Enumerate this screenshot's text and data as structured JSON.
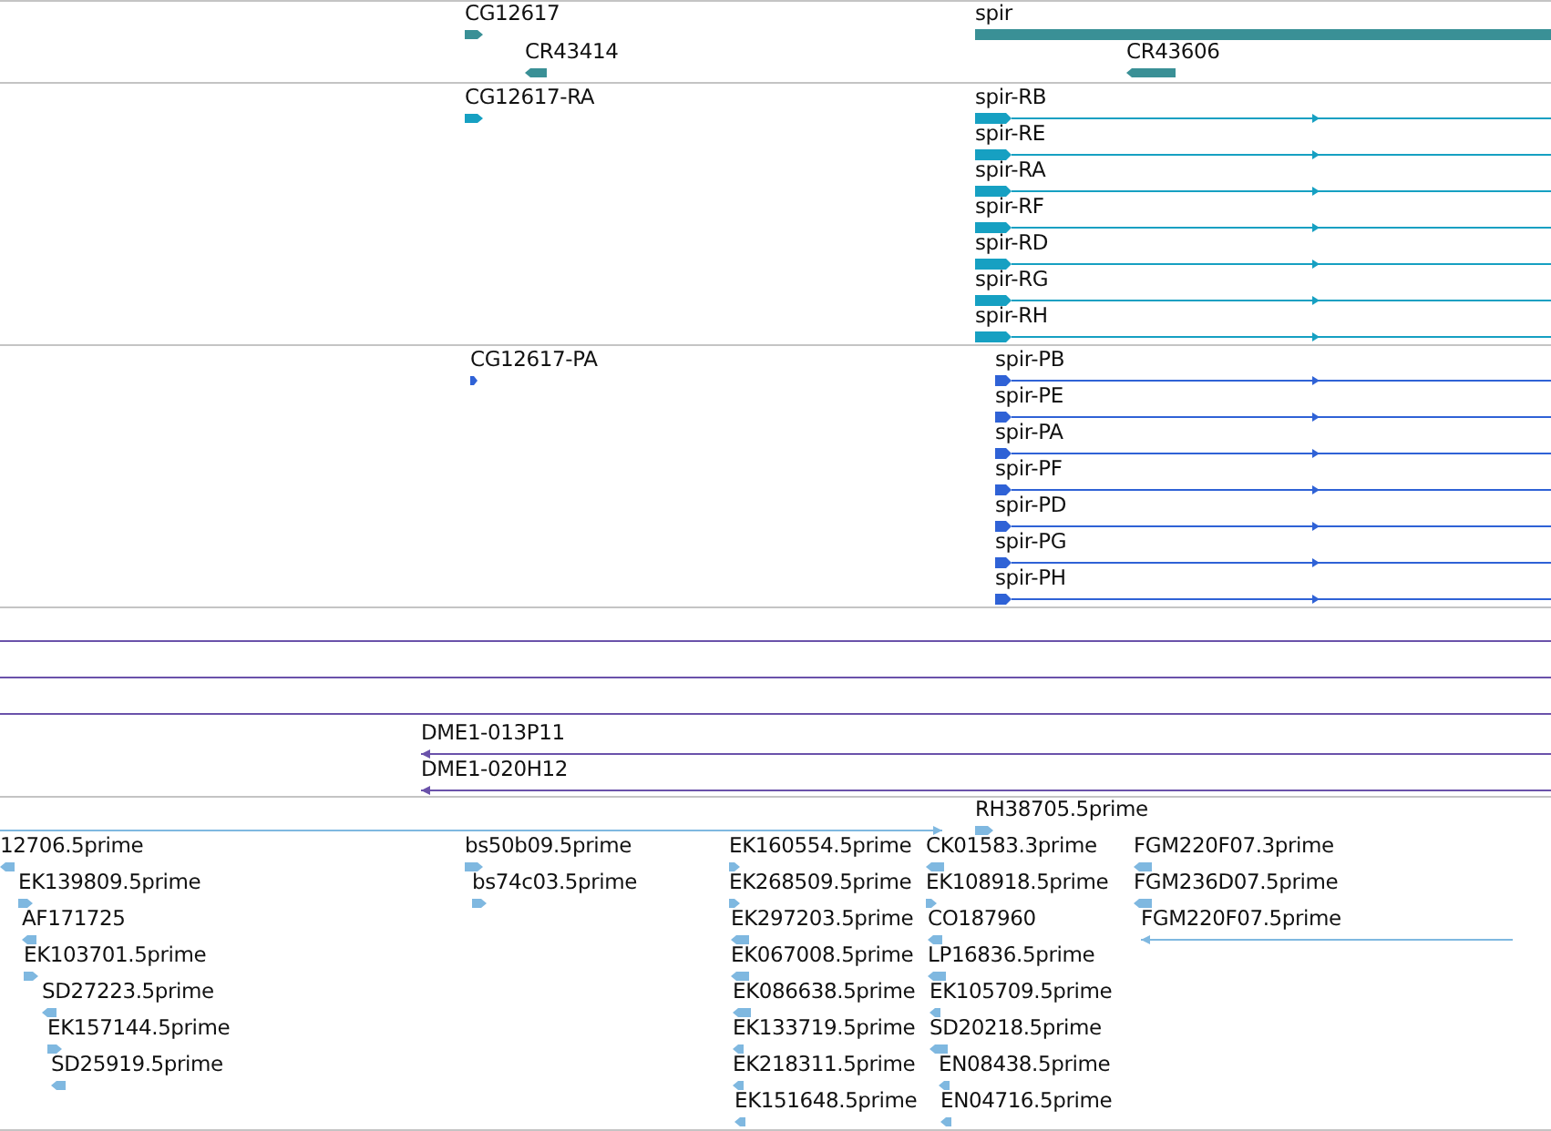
{
  "tracks": [
    {
      "color": "#3a9096",
      "features": [
        {
          "kind": "block",
          "label": "CG12617",
          "reverse": false
        },
        {
          "kind": "block",
          "label": "CR43414",
          "reverse": true
        },
        {
          "kind": "bar",
          "label": "spir"
        },
        {
          "kind": "block",
          "label": "CR43606",
          "reverse": true
        }
      ]
    },
    {
      "color": "#16a0c2",
      "features": [
        {
          "kind": "block",
          "label": "CG12617-RA",
          "reverse": false
        },
        {
          "kind": "transcript",
          "label": "spir-RB",
          "reverse": false
        },
        {
          "kind": "transcript",
          "label": "spir-RE",
          "reverse": false
        },
        {
          "kind": "transcript",
          "label": "spir-RA",
          "reverse": false
        },
        {
          "kind": "transcript",
          "label": "spir-RF",
          "reverse": false
        },
        {
          "kind": "transcript",
          "label": "spir-RD",
          "reverse": false
        },
        {
          "kind": "transcript",
          "label": "spir-RG",
          "reverse": false
        },
        {
          "kind": "transcript",
          "label": "spir-RH",
          "reverse": false
        }
      ]
    },
    {
      "color": "#2f62d6",
      "features": [
        {
          "kind": "block",
          "label": "CG12617-PA",
          "reverse": false
        },
        {
          "kind": "transcript",
          "label": "spir-PB",
          "reverse": false
        },
        {
          "kind": "transcript",
          "label": "spir-PE",
          "reverse": false
        },
        {
          "kind": "transcript",
          "label": "spir-PA",
          "reverse": false
        },
        {
          "kind": "transcript",
          "label": "spir-PF",
          "reverse": false
        },
        {
          "kind": "transcript",
          "label": "spir-PD",
          "reverse": false
        },
        {
          "kind": "transcript",
          "label": "spir-PG",
          "reverse": false
        },
        {
          "kind": "transcript",
          "label": "spir-PH",
          "reverse": false
        }
      ]
    },
    {
      "color": "#6a52aa",
      "features": [
        {
          "kind": "rule"
        },
        {
          "kind": "rule"
        },
        {
          "kind": "rule"
        },
        {
          "kind": "line",
          "label": "DME1-013P11",
          "reverse": true
        },
        {
          "kind": "line",
          "label": "DME1-020H12",
          "reverse": true
        }
      ]
    },
    {
      "color": "#7fb8e0",
      "features": [
        {
          "kind": "line",
          "reverse": false
        },
        {
          "kind": "block",
          "label": "RH38705.5prime",
          "reverse": false
        },
        {
          "kind": "block",
          "label": "12706.5prime",
          "reverse": true
        },
        {
          "kind": "block",
          "label": "EK139809.5prime",
          "reverse": false
        },
        {
          "kind": "block",
          "label": "AF171725",
          "reverse": true
        },
        {
          "kind": "block",
          "label": "EK103701.5prime",
          "reverse": false
        },
        {
          "kind": "block",
          "label": "SD27223.5prime",
          "reverse": true
        },
        {
          "kind": "block",
          "label": "EK157144.5prime",
          "reverse": false
        },
        {
          "kind": "block",
          "label": "SD25919.5prime",
          "reverse": true
        },
        {
          "kind": "block",
          "label": "bs50b09.5prime",
          "reverse": false
        },
        {
          "kind": "block",
          "label": "bs74c03.5prime",
          "reverse": false
        },
        {
          "kind": "block",
          "label": "EK160554.5prime",
          "reverse": false
        },
        {
          "kind": "block",
          "label": "EK268509.5prime",
          "reverse": false
        },
        {
          "kind": "block",
          "label": "EK297203.5prime",
          "reverse": true
        },
        {
          "kind": "block",
          "label": "EK067008.5prime",
          "reverse": true
        },
        {
          "kind": "block",
          "label": "EK086638.5prime",
          "reverse": true
        },
        {
          "kind": "block",
          "label": "EK133719.5prime",
          "reverse": true
        },
        {
          "kind": "block",
          "label": "EK218311.5prime",
          "reverse": true
        },
        {
          "kind": "block",
          "label": "EK151648.5prime",
          "reverse": true
        },
        {
          "kind": "block",
          "label": "CK01583.3prime",
          "reverse": true
        },
        {
          "kind": "block",
          "label": "EK108918.5prime",
          "reverse": false
        },
        {
          "kind": "block",
          "label": "CO187960",
          "reverse": true
        },
        {
          "kind": "block",
          "label": "LP16836.5prime",
          "reverse": true
        },
        {
          "kind": "block",
          "label": "EK105709.5prime",
          "reverse": true
        },
        {
          "kind": "block",
          "label": "SD20218.5prime",
          "reverse": true
        },
        {
          "kind": "block",
          "label": "EN08438.5prime",
          "reverse": true
        },
        {
          "kind": "block",
          "label": "EN04716.5prime",
          "reverse": true
        },
        {
          "kind": "block",
          "label": "FGM220F07.3prime",
          "reverse": true
        },
        {
          "kind": "block",
          "label": "FGM236D07.5prime",
          "reverse": true
        },
        {
          "kind": "line",
          "label": "FGM220F07.5prime",
          "reverse": true
        }
      ]
    }
  ]
}
